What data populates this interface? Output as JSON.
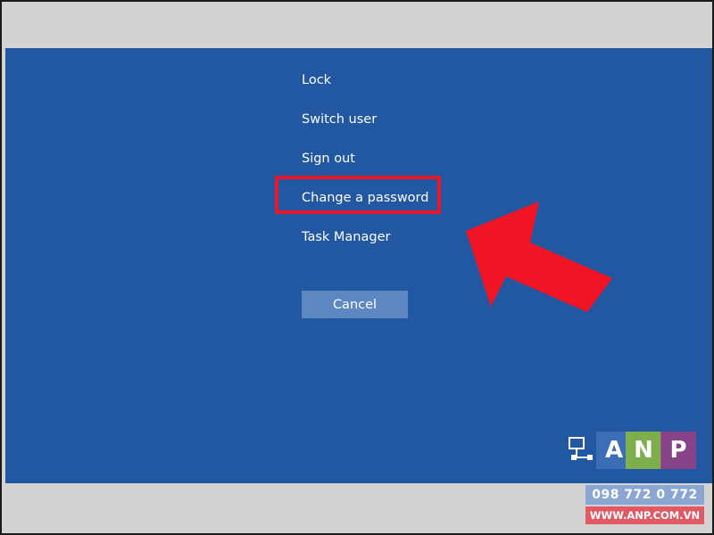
{
  "menu": {
    "lock": "Lock",
    "switch_user": "Switch user",
    "sign_out": "Sign out",
    "change_password": "Change a password",
    "task_manager": "Task Manager"
  },
  "cancel_label": "Cancel",
  "annotation": {
    "highlight_color": "#e8162a",
    "arrow_color": "#f01424"
  },
  "colors": {
    "screen_background": "#2257a1",
    "frame_background": "#d3d3d3",
    "cancel_background": "#5d87c0"
  },
  "watermark": {
    "logo_text": "ANP",
    "logo_icon": "network-monitor-icon",
    "phone": "098 772 0 772",
    "website": "WWW.ANP.COM.VN"
  }
}
